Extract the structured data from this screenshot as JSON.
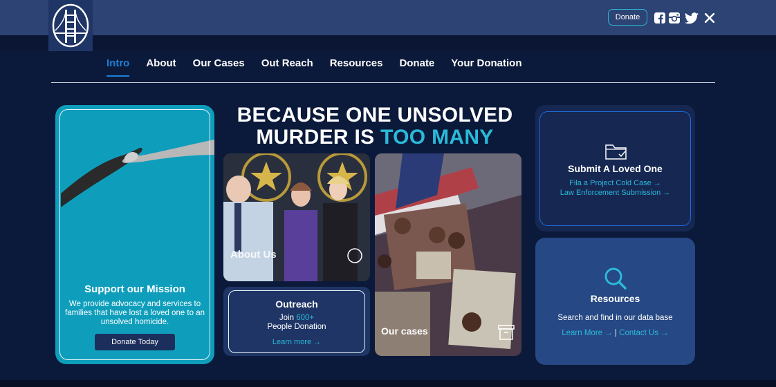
{
  "header": {
    "donate_label": "Donate",
    "social": [
      "facebook-icon",
      "instagram-icon",
      "twitter-icon",
      "x-icon"
    ]
  },
  "nav": {
    "items": [
      {
        "label": "Intro",
        "active": true
      },
      {
        "label": "About"
      },
      {
        "label": "Our Cases"
      },
      {
        "label": "Out Reach"
      },
      {
        "label": "Resources"
      },
      {
        "label": "Donate"
      },
      {
        "label": "Your Donation"
      }
    ]
  },
  "hero": {
    "line1": "BECAUSE ONE UNSOLVED",
    "line2_prefix": "MURDER IS ",
    "line2_accent": "TOO MANY"
  },
  "mission": {
    "title": "Support our Mission",
    "text": "We provide advocacy and services to families that have lost a loved one to an unsolved homicide.",
    "button": "Donate Today"
  },
  "about_card": {
    "caption": "About Us"
  },
  "outreach": {
    "title": "Outreach",
    "join_prefix": "Join ",
    "join_count": "600+",
    "join_suffix": "People Donation",
    "learn_more": "Learn more →"
  },
  "cases_card": {
    "caption": "Our cases"
  },
  "submit": {
    "title": "Submit A Loved One",
    "link1": "Fila a Project Cold Case →",
    "link2": "Law Enforcement Submission →"
  },
  "resources": {
    "title": "Resources",
    "desc": "Search and find in our data base",
    "link1": "Learn More →",
    "sep": "|",
    "link2": "Contact Us →"
  },
  "colors": {
    "page_bg": "#0b1a3a",
    "topbar": "#2d4373",
    "accent": "#2bb9d9",
    "active_nav": "#1f7fd8",
    "mission_bg": "#0e9ebc"
  }
}
